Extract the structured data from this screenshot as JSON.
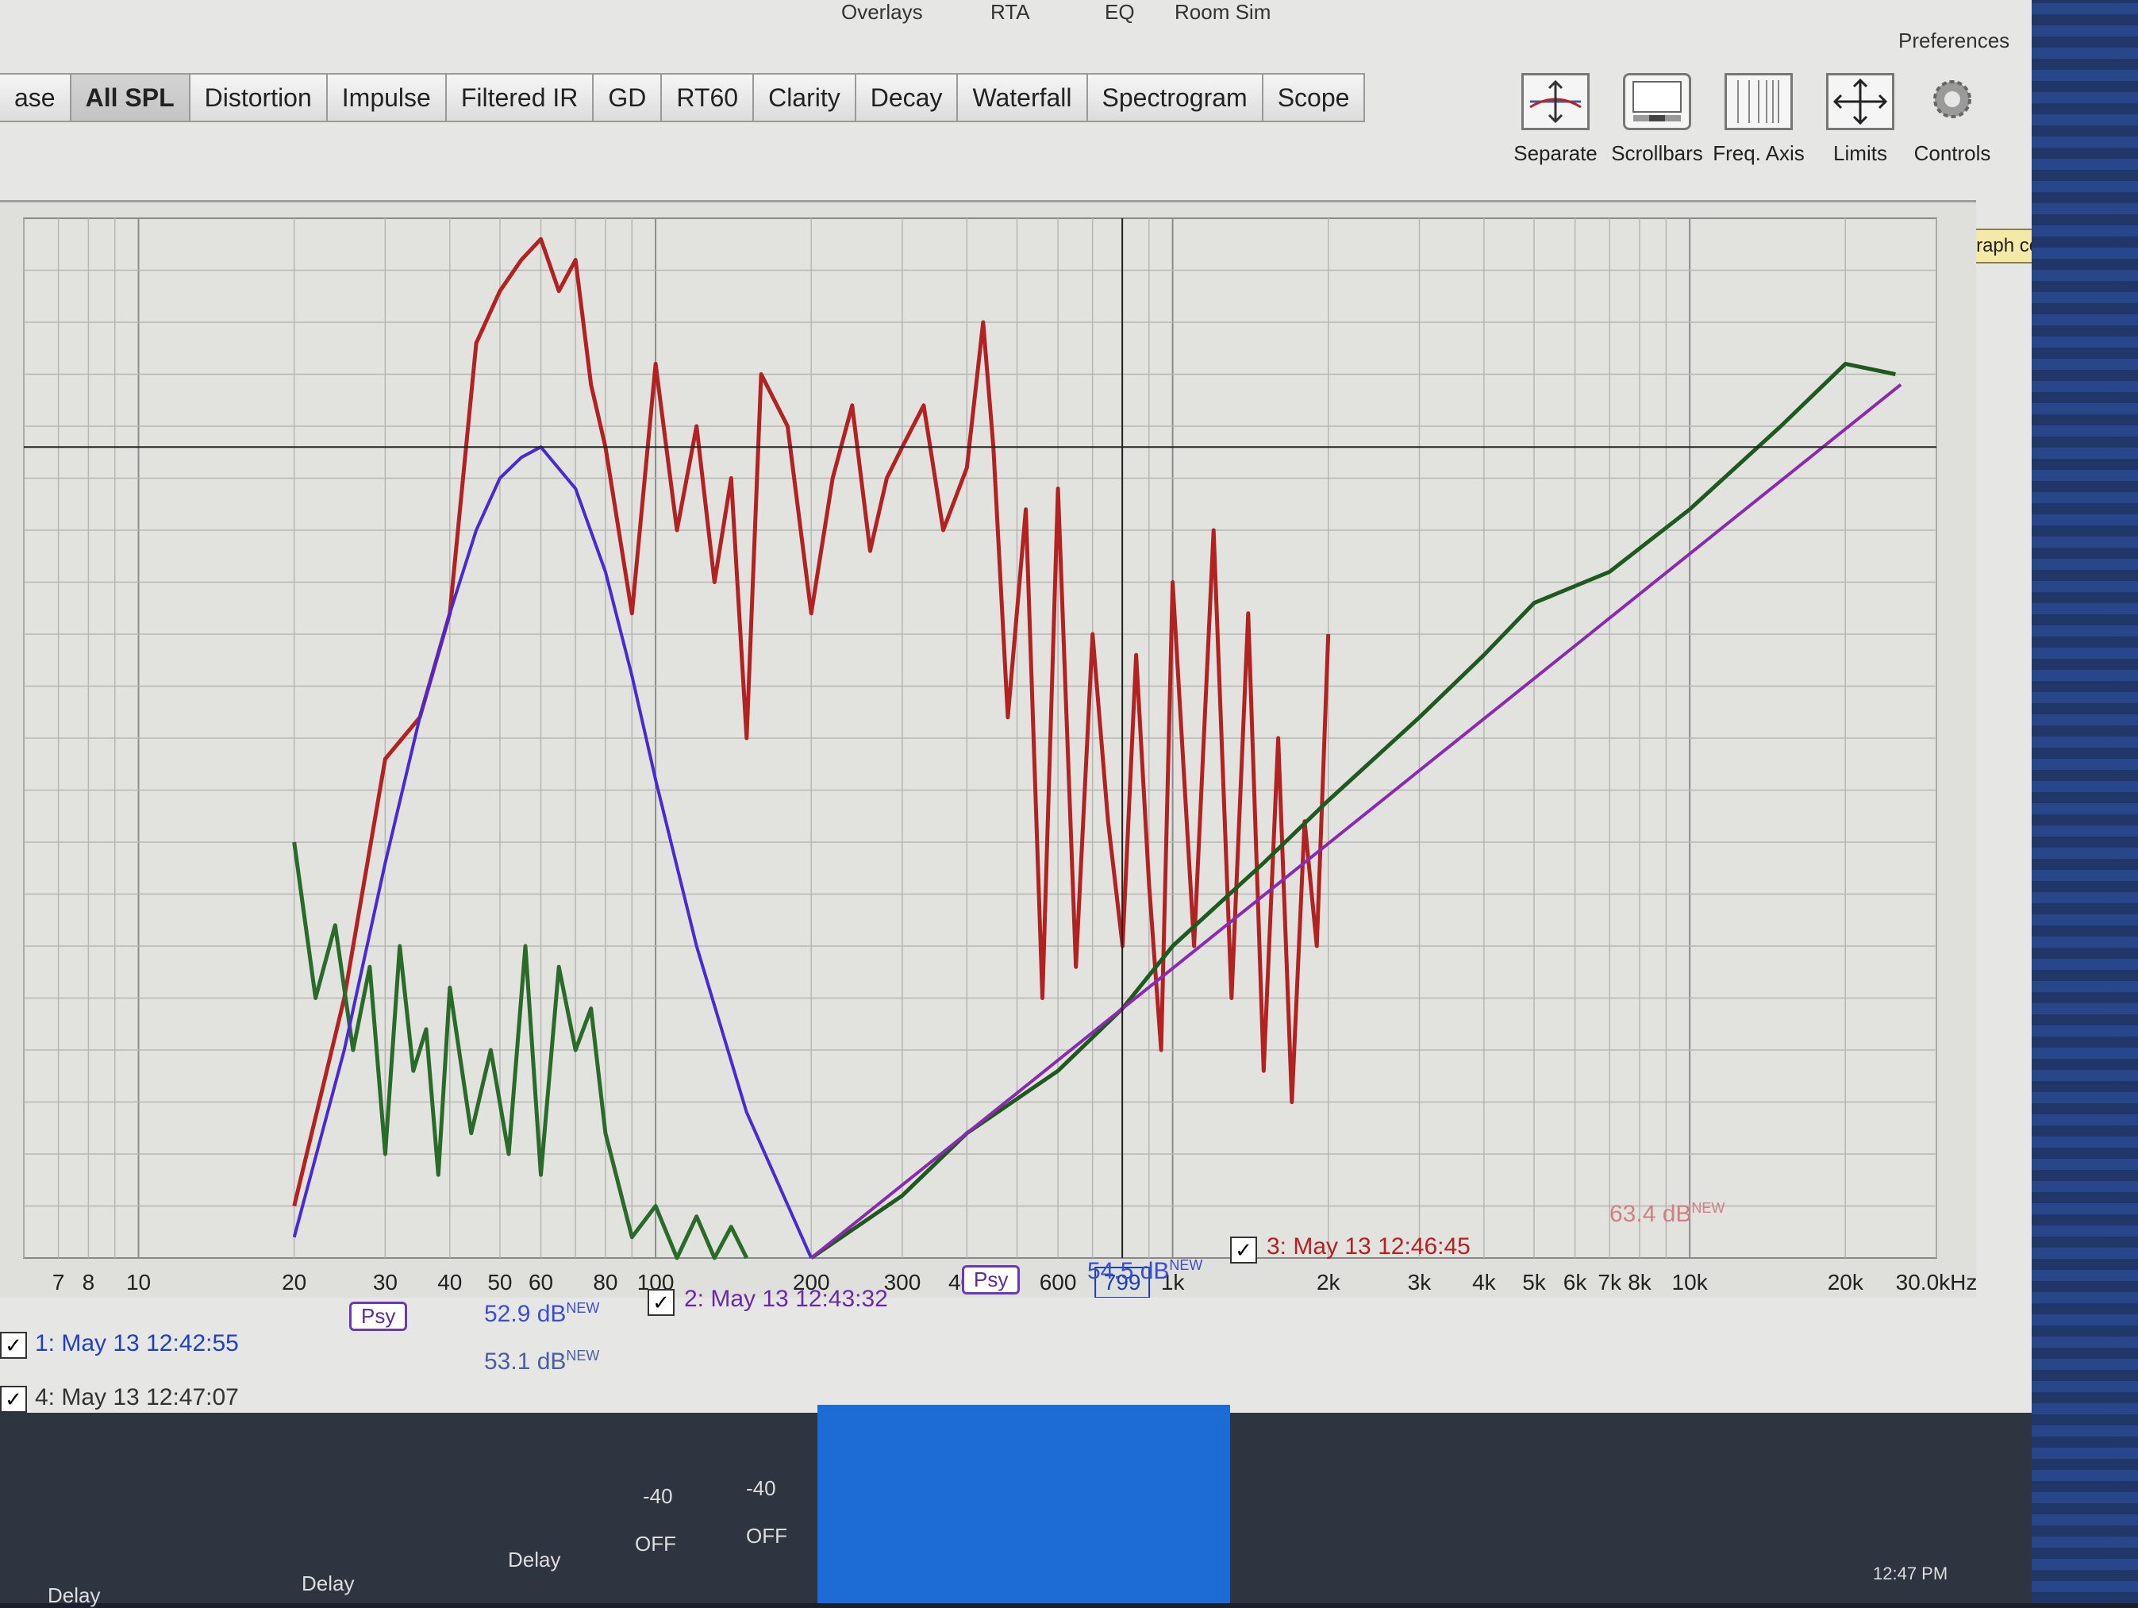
{
  "menu_top": {
    "items": [
      "Overlays",
      "RTA",
      "EQ",
      "Room Sim"
    ]
  },
  "preferences_label": "Preferences",
  "tabs": [
    "ase",
    "All SPL",
    "Distortion",
    "Impulse",
    "Filtered IR",
    "GD",
    "RT60",
    "Clarity",
    "Decay",
    "Waterfall",
    "Spectrogram",
    "Scope"
  ],
  "toolbar": {
    "separate": "Separate",
    "scrollbars": "Scrollbars",
    "freq_axis": "Freq. Axis",
    "limits": "Limits",
    "controls": "Controls"
  },
  "tooltip": "Show the graph controls",
  "cursor_readout": "799",
  "chart_data": {
    "type": "line",
    "x_scale": "log",
    "xlim": [
      6,
      30000
    ],
    "x_tick_labels": [
      "7",
      "8",
      "10",
      "20",
      "30",
      "40",
      "50",
      "60",
      "80",
      "100",
      "200",
      "300",
      "400",
      "600",
      "799",
      "1k",
      "2k",
      "3k",
      "4k",
      "5k",
      "6k",
      "7k",
      "8k",
      "10k",
      "20k",
      "30.0kHz"
    ],
    "series": [
      {
        "color": "#b22222",
        "x": [
          20,
          25,
          30,
          35,
          40,
          45,
          50,
          55,
          60,
          65,
          70,
          75,
          80,
          90,
          100,
          110,
          120,
          130,
          140,
          150,
          160,
          180,
          200,
          220,
          240,
          260,
          280,
          300,
          330,
          360,
          400,
          430,
          450,
          480,
          520,
          560,
          600,
          650,
          700,
          750,
          800,
          850,
          900,
          950,
          1000,
          1100,
          1200,
          1300,
          1400,
          1500,
          1600,
          1700,
          1800,
          1900,
          2000
        ],
        "y": [
          0.05,
          0.25,
          0.48,
          0.52,
          0.62,
          0.88,
          0.93,
          0.96,
          0.98,
          0.93,
          0.96,
          0.84,
          0.78,
          0.62,
          0.86,
          0.7,
          0.8,
          0.65,
          0.75,
          0.5,
          0.85,
          0.8,
          0.62,
          0.75,
          0.82,
          0.68,
          0.75,
          0.78,
          0.82,
          0.7,
          0.76,
          0.9,
          0.78,
          0.52,
          0.72,
          0.25,
          0.74,
          0.28,
          0.6,
          0.42,
          0.3,
          0.58,
          0.36,
          0.2,
          0.65,
          0.3,
          0.7,
          0.25,
          0.62,
          0.18,
          0.5,
          0.15,
          0.42,
          0.3,
          0.6
        ]
      },
      {
        "color": "#2a6b2a",
        "x": [
          20,
          22,
          24,
          26,
          28,
          30,
          32,
          34,
          36,
          38,
          40,
          44,
          48,
          52,
          56,
          60,
          65,
          70,
          75,
          80,
          90,
          100,
          110,
          120,
          130,
          140,
          150
        ],
        "y": [
          0.4,
          0.25,
          0.32,
          0.2,
          0.28,
          0.1,
          0.3,
          0.18,
          0.22,
          0.08,
          0.26,
          0.12,
          0.2,
          0.1,
          0.3,
          0.08,
          0.28,
          0.2,
          0.24,
          0.12,
          0.02,
          0.05,
          0.0,
          0.04,
          0.0,
          0.03,
          0.0
        ]
      },
      {
        "color": "#4a2ad0",
        "x": [
          20,
          25,
          30,
          35,
          40,
          45,
          50,
          55,
          60,
          70,
          80,
          90,
          100,
          120,
          150,
          200
        ],
        "y": [
          0.02,
          0.2,
          0.38,
          0.52,
          0.62,
          0.7,
          0.75,
          0.77,
          0.78,
          0.74,
          0.66,
          0.56,
          0.46,
          0.3,
          0.14,
          0.0
        ]
      },
      {
        "color": "#1e5a1e",
        "x": [
          200,
          300,
          400,
          600,
          800,
          1000,
          1500,
          2000,
          3000,
          4000,
          5000,
          7000,
          10000,
          15000,
          20000,
          25000
        ],
        "y": [
          0.0,
          0.06,
          0.12,
          0.18,
          0.24,
          0.3,
          0.38,
          0.44,
          0.52,
          0.58,
          0.63,
          0.66,
          0.72,
          0.8,
          0.86,
          0.85
        ]
      },
      {
        "color": "#8a2ab0",
        "x": [
          200,
          400,
          800,
          1600,
          3200,
          6400,
          12800,
          25600
        ],
        "y": [
          0.0,
          0.12,
          0.24,
          0.36,
          0.48,
          0.6,
          0.72,
          0.84
        ]
      }
    ]
  },
  "legend": {
    "m1": {
      "label": "1: May 13 12:42:55",
      "value": "52.9 dB",
      "new": "NEW"
    },
    "m2": {
      "label": "2: May 13 12:43:32",
      "value": "54.5 dB",
      "new": "NEW"
    },
    "m3": {
      "label": "3: May 13 12:46:45",
      "value": "63.4 dB",
      "new": "NEW"
    },
    "m4": {
      "label": "4: May 13 12:47:07",
      "value": "53.1 dB",
      "new": "NEW"
    },
    "psy": "Psy"
  },
  "bottom_panel": {
    "delay_1": "Delay",
    "delay_2": "Delay",
    "delay_3": "Delay",
    "minus40_a": "-40",
    "minus40_b": "-40",
    "off_a": "OFF",
    "off_b": "OFF"
  },
  "taskbar_time": "12:47 PM"
}
